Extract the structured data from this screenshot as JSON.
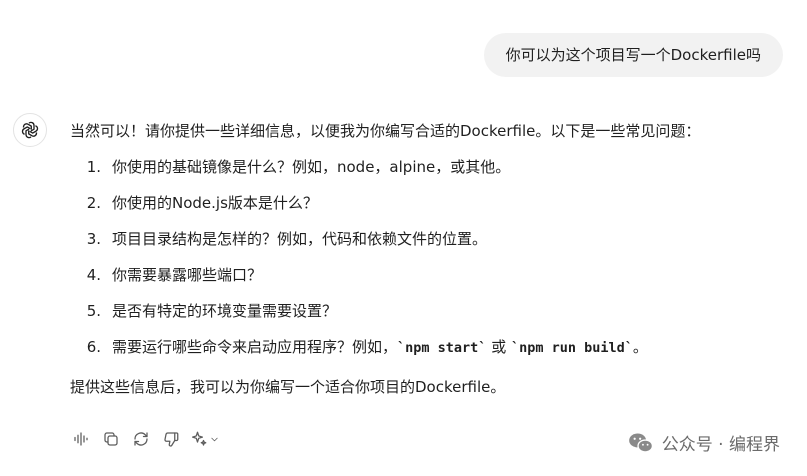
{
  "user_message": "你可以为这个项目写一个Dockerfile吗",
  "assistant": {
    "intro": "当然可以！请你提供一些详细信息，以便我为你编写合适的Dockerfile。以下是一些常见问题：",
    "steps": [
      {
        "num": "1.",
        "text": "你使用的基础镜像是什么？例如，node，alpine，或其他。"
      },
      {
        "num": "2.",
        "text": "你使用的Node.js版本是什么？"
      },
      {
        "num": "3.",
        "text": "项目目录结构是怎样的？例如，代码和依赖文件的位置。"
      },
      {
        "num": "4.",
        "text": "你需要暴露哪些端口？"
      },
      {
        "num": "5.",
        "text": "是否有特定的环境变量需要设置？"
      },
      {
        "num": "6.",
        "pre": "需要运行哪些命令来启动应用程序？例如，",
        "code1": "`npm start`",
        "mid": " 或 ",
        "code2": "`npm run build`",
        "post": "。"
      }
    ],
    "outro": "提供这些信息后，我可以为你编写一个适合你项目的Dockerfile。"
  },
  "actions": [
    "speaker-icon",
    "copy-icon",
    "regenerate-icon",
    "thumbs-down-icon",
    "sparkle-icon"
  ],
  "watermark": "公众号 · 编程界",
  "colors": {
    "user_bubble": "#f2f2f2",
    "text": "#1f1f1f",
    "icon": "#5d5d5d",
    "watermark": "#6b6b6b"
  }
}
